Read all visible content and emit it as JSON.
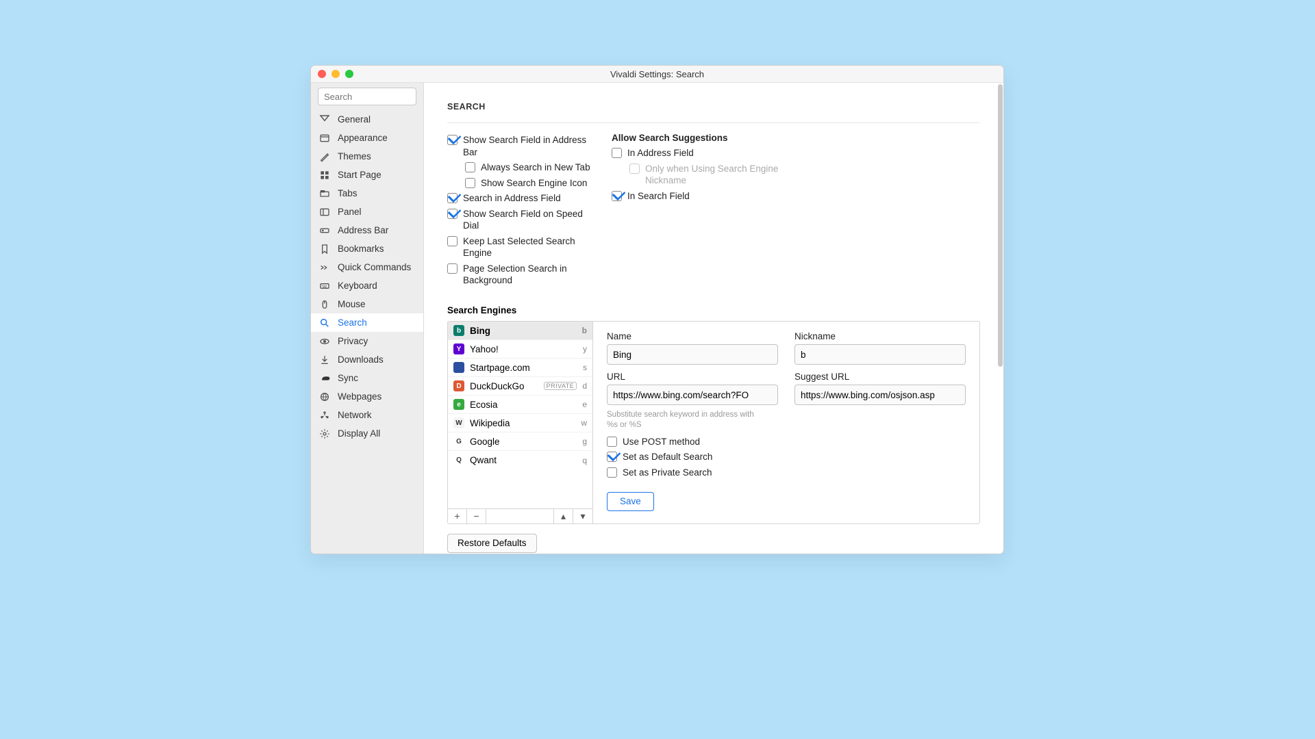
{
  "window": {
    "title": "Vivaldi Settings: Search"
  },
  "sidebar": {
    "search_placeholder": "Search",
    "items": [
      {
        "label": "General"
      },
      {
        "label": "Appearance"
      },
      {
        "label": "Themes"
      },
      {
        "label": "Start Page"
      },
      {
        "label": "Tabs"
      },
      {
        "label": "Panel"
      },
      {
        "label": "Address Bar"
      },
      {
        "label": "Bookmarks"
      },
      {
        "label": "Quick Commands"
      },
      {
        "label": "Keyboard"
      },
      {
        "label": "Mouse"
      },
      {
        "label": "Search"
      },
      {
        "label": "Privacy"
      },
      {
        "label": "Downloads"
      },
      {
        "label": "Sync"
      },
      {
        "label": "Webpages"
      },
      {
        "label": "Network"
      },
      {
        "label": "Display All"
      }
    ]
  },
  "main": {
    "heading": "SEARCH",
    "left_options": {
      "show_field_addr": "Show Search Field in Address Bar",
      "always_new_tab": "Always Search in New Tab",
      "show_engine_icon": "Show Search Engine Icon",
      "search_in_addr": "Search in Address Field",
      "show_on_speed": "Show Search Field on Speed Dial",
      "keep_last": "Keep Last Selected Search Engine",
      "page_select_bg": "Page Selection Search in Background"
    },
    "right_options": {
      "heading": "Allow Search Suggestions",
      "in_address": "In Address Field",
      "only_nickname": "Only when Using Search Engine Nickname",
      "in_search": "In Search Field"
    },
    "engines_heading": "Search Engines",
    "engines": [
      {
        "name": "Bing",
        "key": "b",
        "icon_bg": "#0a7d6c",
        "icon_txt": "b",
        "badge": ""
      },
      {
        "name": "Yahoo!",
        "key": "y",
        "icon_bg": "#5f01d1",
        "icon_txt": "Y",
        "badge": ""
      },
      {
        "name": "Startpage.com",
        "key": "s",
        "icon_bg": "#2b50a0",
        "icon_txt": "",
        "badge": ""
      },
      {
        "name": "DuckDuckGo",
        "key": "d",
        "icon_bg": "#de5833",
        "icon_txt": "D",
        "badge": "PRIVATE"
      },
      {
        "name": "Ecosia",
        "key": "e",
        "icon_bg": "#36a93f",
        "icon_txt": "e",
        "badge": ""
      },
      {
        "name": "Wikipedia",
        "key": "w",
        "icon_bg": "#f4f4f4",
        "icon_txt": "W",
        "badge": ""
      },
      {
        "name": "Google",
        "key": "g",
        "icon_bg": "#ffffff",
        "icon_txt": "G",
        "badge": ""
      },
      {
        "name": "Qwant",
        "key": "q",
        "icon_bg": "#ffffff",
        "icon_txt": "Q",
        "badge": ""
      }
    ],
    "toolbar": {
      "add": "+",
      "remove": "−",
      "up": "▴",
      "down": "▾"
    },
    "form": {
      "name_label": "Name",
      "name_value": "Bing",
      "nick_label": "Nickname",
      "nick_value": "b",
      "url_label": "URL",
      "url_value": "https://www.bing.com/search?FO",
      "surl_label": "Suggest URL",
      "surl_value": "https://www.bing.com/osjson.asp",
      "hint": "Substitute search keyword in address with %s or %S",
      "use_post": "Use POST method",
      "set_default": "Set as Default Search",
      "set_private": "Set as Private Search",
      "save": "Save"
    },
    "restore": "Restore Defaults"
  }
}
